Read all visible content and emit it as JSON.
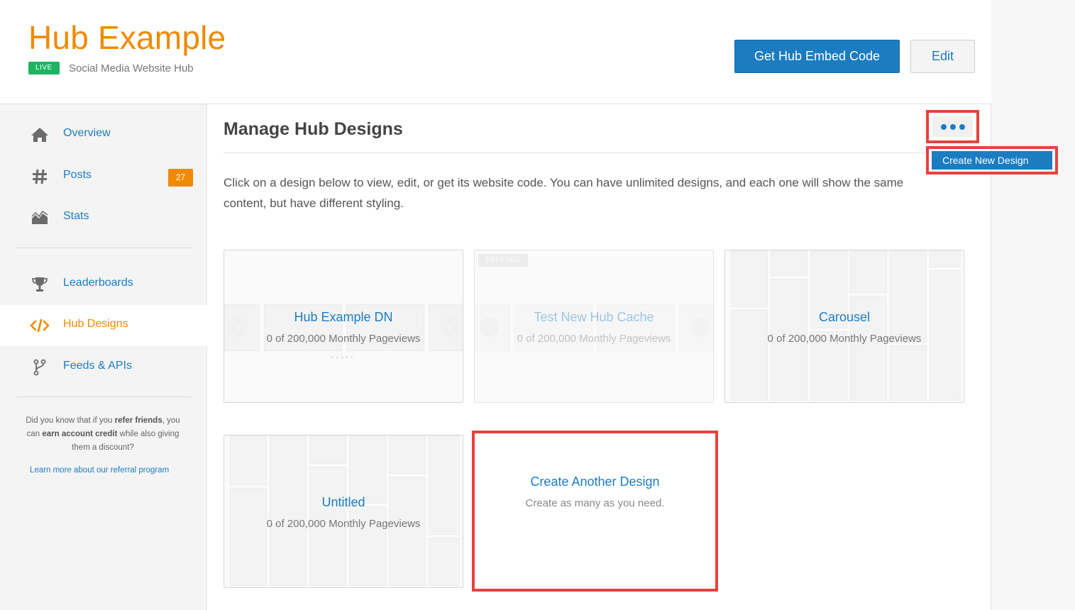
{
  "header": {
    "title": "Hub Example",
    "status_badge": "LIVE",
    "subtitle": "Social Media Website Hub",
    "embed_button": "Get Hub Embed Code",
    "edit_button": "Edit"
  },
  "sidebar": {
    "items": [
      {
        "label": "Overview",
        "icon": "home-icon"
      },
      {
        "label": "Posts",
        "icon": "hashtag-icon",
        "badge": "27"
      },
      {
        "label": "Stats",
        "icon": "stats-chart-icon"
      },
      {
        "label": "Leaderboards",
        "icon": "trophy-icon"
      },
      {
        "label": "Hub Designs",
        "icon": "code-icon",
        "active": true
      },
      {
        "label": "Feeds & APIs",
        "icon": "fork-icon"
      }
    ],
    "referral": {
      "text_1": "Did you know that if you ",
      "text_bold_1": "refer friends",
      "text_2": ", you can ",
      "text_bold_2": "earn account credit",
      "text_3": " while also giving them a discount?",
      "link": "Learn more about our referral program"
    }
  },
  "main": {
    "title": "Manage Hub Designs",
    "more_menu_icon": "more-dots-icon",
    "create_new_button": "Create New Design",
    "intro": "Click on a design below to view, edit, or get its website code. You can have unlimited designs, and each one will show the same content, but have different styling.",
    "designs": [
      {
        "name": "Hub Example DN",
        "views": "0 of 200,000 Monthly Pageviews"
      },
      {
        "name": "Test New Hub Cache",
        "views": "0 of 200,000 Monthly Pageviews",
        "badge": "DELETED"
      },
      {
        "name": "Carousel",
        "views": "0 of 200,000 Monthly Pageviews"
      },
      {
        "name": "Untitled",
        "views": "0 of 200,000 Monthly Pageviews"
      }
    ],
    "create_card": {
      "title": "Create Another Design",
      "subtitle": "Create as many as you need."
    }
  },
  "colors": {
    "accent_orange": "#f08a00",
    "link_blue": "#1c7cc2",
    "live_green": "#1fb361",
    "highlight_red": "#e8413e"
  }
}
